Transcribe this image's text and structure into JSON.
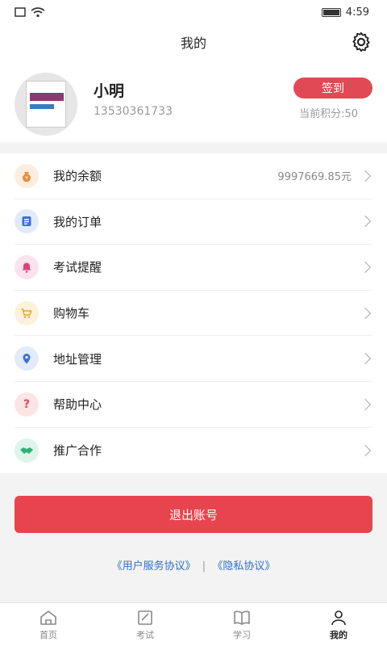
{
  "status_bar": {
    "time": "4:59"
  },
  "header": {
    "title": "我的"
  },
  "profile": {
    "name": "小明",
    "phone": "13530361733",
    "signin_label": "签到",
    "points": "当前积分:50"
  },
  "menu": {
    "items": [
      {
        "label": "我的余额",
        "value": "9997669.85元",
        "icon": "money-bag-icon",
        "color": "#e98a3b"
      },
      {
        "label": "我的订单",
        "value": "",
        "icon": "order-list-icon",
        "color": "#3a6fd8"
      },
      {
        "label": "考试提醒",
        "value": "",
        "icon": "bell-icon",
        "color": "#e0407a"
      },
      {
        "label": "购物车",
        "value": "",
        "icon": "cart-icon",
        "color": "#e8a52a"
      },
      {
        "label": "地址管理",
        "value": "",
        "icon": "location-icon",
        "color": "#3a6fd8"
      },
      {
        "label": "帮助中心",
        "value": "",
        "icon": "question-icon",
        "color": "#e14a55"
      },
      {
        "label": "推广合作",
        "value": "",
        "icon": "handshake-icon",
        "color": "#2fb07a"
      }
    ]
  },
  "logout_label": "退出账号",
  "agreements": {
    "user": "《用户服务协议》",
    "separator": "|",
    "privacy": "《隐私协议》"
  },
  "tabbar": {
    "tabs": [
      {
        "label": "首页",
        "icon": "home-icon"
      },
      {
        "label": "考试",
        "icon": "exam-icon"
      },
      {
        "label": "学习",
        "icon": "book-icon"
      },
      {
        "label": "我的",
        "icon": "user-icon",
        "active": true
      }
    ]
  }
}
